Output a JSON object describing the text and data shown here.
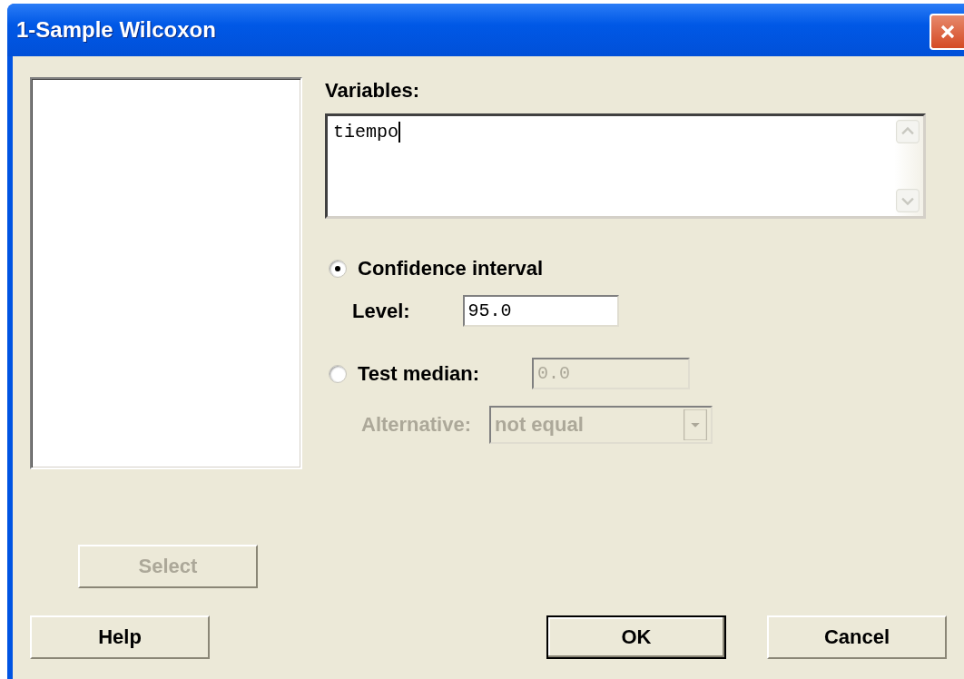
{
  "window": {
    "title": "1-Sample Wilcoxon"
  },
  "variables": {
    "label": "Variables:",
    "value": "tiempo"
  },
  "options": [
    {
      "kind": "interval",
      "label": "Confidence interval",
      "selected": true,
      "field_label": "Level:",
      "value": "95.0",
      "disabled": false
    },
    {
      "kind": "median",
      "label": "Test median:",
      "selected": false,
      "value": "0.0",
      "disabled": true
    }
  ],
  "alternative": {
    "label": "Alternative:",
    "value": "not equal",
    "disabled": true
  },
  "select_button": {
    "label": "Select",
    "disabled": true
  },
  "buttons": [
    {
      "label": "Help",
      "default": false
    },
    {
      "label": "OK",
      "default": true
    },
    {
      "label": "Cancel",
      "default": false
    }
  ]
}
